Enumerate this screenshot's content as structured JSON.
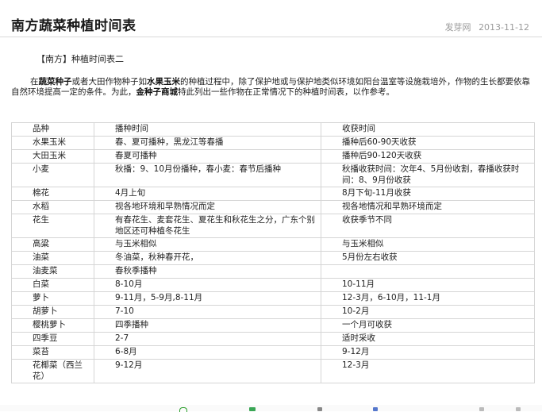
{
  "article": {
    "title": "南方蔬菜种植时间表",
    "source": "发芽网",
    "date": "2013-11-12"
  },
  "subheading": "【南方】种植时间表二",
  "intro": {
    "p1": "在",
    "link1": "蔬菜种子",
    "p2": "或者大田作物种子如",
    "link2": "水果玉米",
    "p3": "的种植过程中，除了保护地或与保护地类似环境如阳台温室等设施栽培外，作物的生长都要依靠自然环境提高一定的条件。为此，",
    "link3": "金种子商城",
    "p4": "特此列出一些作物在正常情况下的种植时间表，以作参考。"
  },
  "table": {
    "headers": [
      "品种",
      "播种时间",
      "收获时间"
    ],
    "rows": [
      [
        "水果玉米",
        "春、夏可播种，黑龙江等春播",
        "播种后60-90天收获"
      ],
      [
        "大田玉米",
        "春夏可播种",
        "播种后90-120天收获"
      ],
      [
        "小麦",
        "秋播：9、10月份播种，春小麦：春节后播种",
        "秋播收获时间：次年4、5月份收割，春播收获时间：8、9月份收获"
      ],
      [
        "棉花",
        "4月上旬",
        "8月下旬-11月收获"
      ],
      [
        "水稻",
        "视各地环境和早熟情况而定",
        "视各地情况和早熟环境而定"
      ],
      [
        "花生",
        "有春花生、麦套花生、夏花生和秋花生之分，广东个别地区还可种植冬花生",
        "收获季节不同"
      ],
      [
        "高粱",
        "与玉米相似",
        "与玉米相似"
      ],
      [
        "油菜",
        "冬油菜，秋种春开花，",
        "5月份左右收获"
      ],
      [
        "油麦菜",
        "春秋季播种",
        ""
      ],
      [
        "白菜",
        "8-10月",
        "10-11月"
      ],
      [
        "萝卜",
        "9-11月，5-9月,8-11月",
        "12-3月，6-10月，11-1月"
      ],
      [
        "胡萝卜",
        "7-10",
        "10-2月"
      ],
      [
        "樱桃萝卜",
        "四季播种",
        "一个月可收获"
      ],
      [
        "四季豆",
        "2-7",
        "适时采收"
      ],
      [
        "菜苔",
        "6-8月",
        "9-12月"
      ],
      [
        "花椰菜（西兰花）",
        "9-12月",
        "12-3月"
      ]
    ]
  },
  "colors": {
    "title": "#1a1a1a",
    "meta": "#9a9a9a",
    "border": "#d5d5d5"
  }
}
